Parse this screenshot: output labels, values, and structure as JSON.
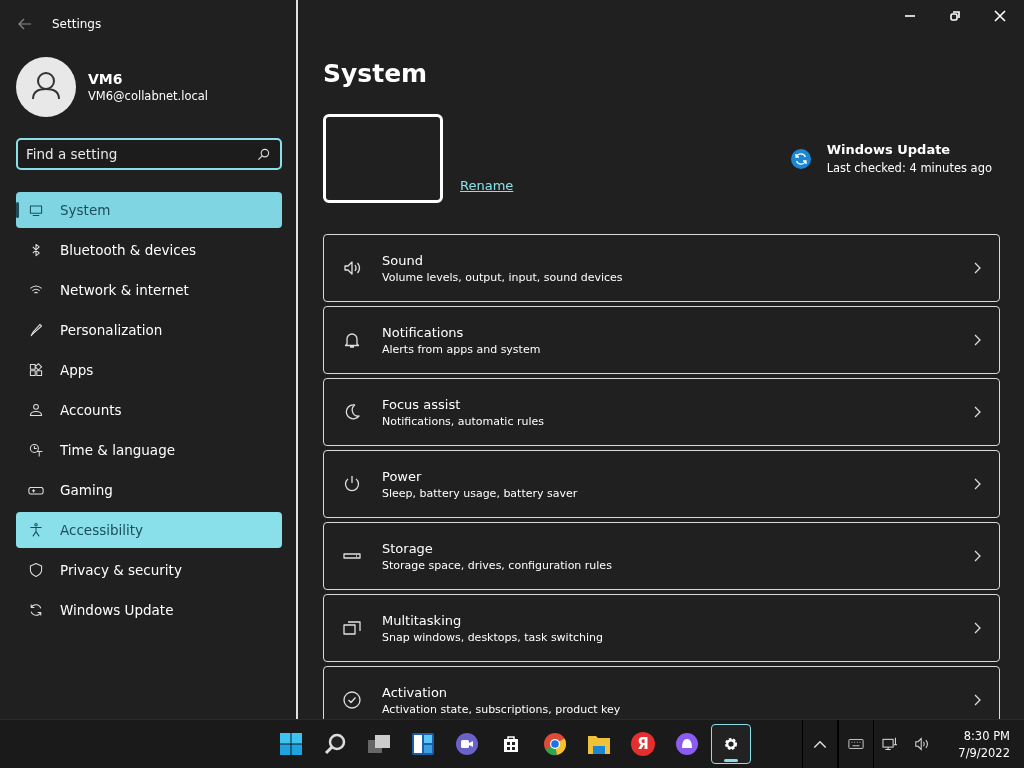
{
  "window": {
    "title": "Settings"
  },
  "account": {
    "name": "VM6",
    "email": "VM6@collabnet.local"
  },
  "search": {
    "placeholder": "Find a setting"
  },
  "sidebar": {
    "items": [
      {
        "label": "System",
        "selected": true,
        "hovered": false
      },
      {
        "label": "Bluetooth & devices",
        "selected": false,
        "hovered": false
      },
      {
        "label": "Network & internet",
        "selected": false,
        "hovered": false
      },
      {
        "label": "Personalization",
        "selected": false,
        "hovered": false
      },
      {
        "label": "Apps",
        "selected": false,
        "hovered": false
      },
      {
        "label": "Accounts",
        "selected": false,
        "hovered": false
      },
      {
        "label": "Time & language",
        "selected": false,
        "hovered": false
      },
      {
        "label": "Gaming",
        "selected": false,
        "hovered": false
      },
      {
        "label": "Accessibility",
        "selected": false,
        "hovered": true
      },
      {
        "label": "Privacy & security",
        "selected": false,
        "hovered": false
      },
      {
        "label": "Windows Update",
        "selected": false,
        "hovered": false
      }
    ]
  },
  "page": {
    "title": "System",
    "rename": "Rename",
    "update": {
      "title": "Windows Update",
      "status": "Last checked: 4 minutes ago"
    }
  },
  "cards": [
    {
      "title": "Sound",
      "subtitle": "Volume levels, output, input, sound devices"
    },
    {
      "title": "Notifications",
      "subtitle": "Alerts from apps and system"
    },
    {
      "title": "Focus assist",
      "subtitle": "Notifications, automatic rules"
    },
    {
      "title": "Power",
      "subtitle": "Sleep, battery usage, battery saver"
    },
    {
      "title": "Storage",
      "subtitle": "Storage space, drives, configuration rules"
    },
    {
      "title": "Multitasking",
      "subtitle": "Snap windows, desktops, task switching"
    },
    {
      "title": "Activation",
      "subtitle": "Activation state, subscriptions, product key"
    }
  ],
  "taskbar": {
    "apps": [
      {
        "kind": "start",
        "selected": false
      },
      {
        "kind": "search",
        "selected": false
      },
      {
        "kind": "taskview",
        "selected": false
      },
      {
        "kind": "widgets",
        "selected": false
      },
      {
        "kind": "chat",
        "selected": false
      },
      {
        "kind": "store",
        "selected": false
      },
      {
        "kind": "chrome",
        "selected": false
      },
      {
        "kind": "explorer",
        "selected": false
      },
      {
        "kind": "yandex",
        "selected": false,
        "glyph": "Я"
      },
      {
        "kind": "alice",
        "selected": false
      },
      {
        "kind": "settings",
        "selected": true
      }
    ],
    "time": "8:30 PM",
    "date": "7/9/2022"
  }
}
